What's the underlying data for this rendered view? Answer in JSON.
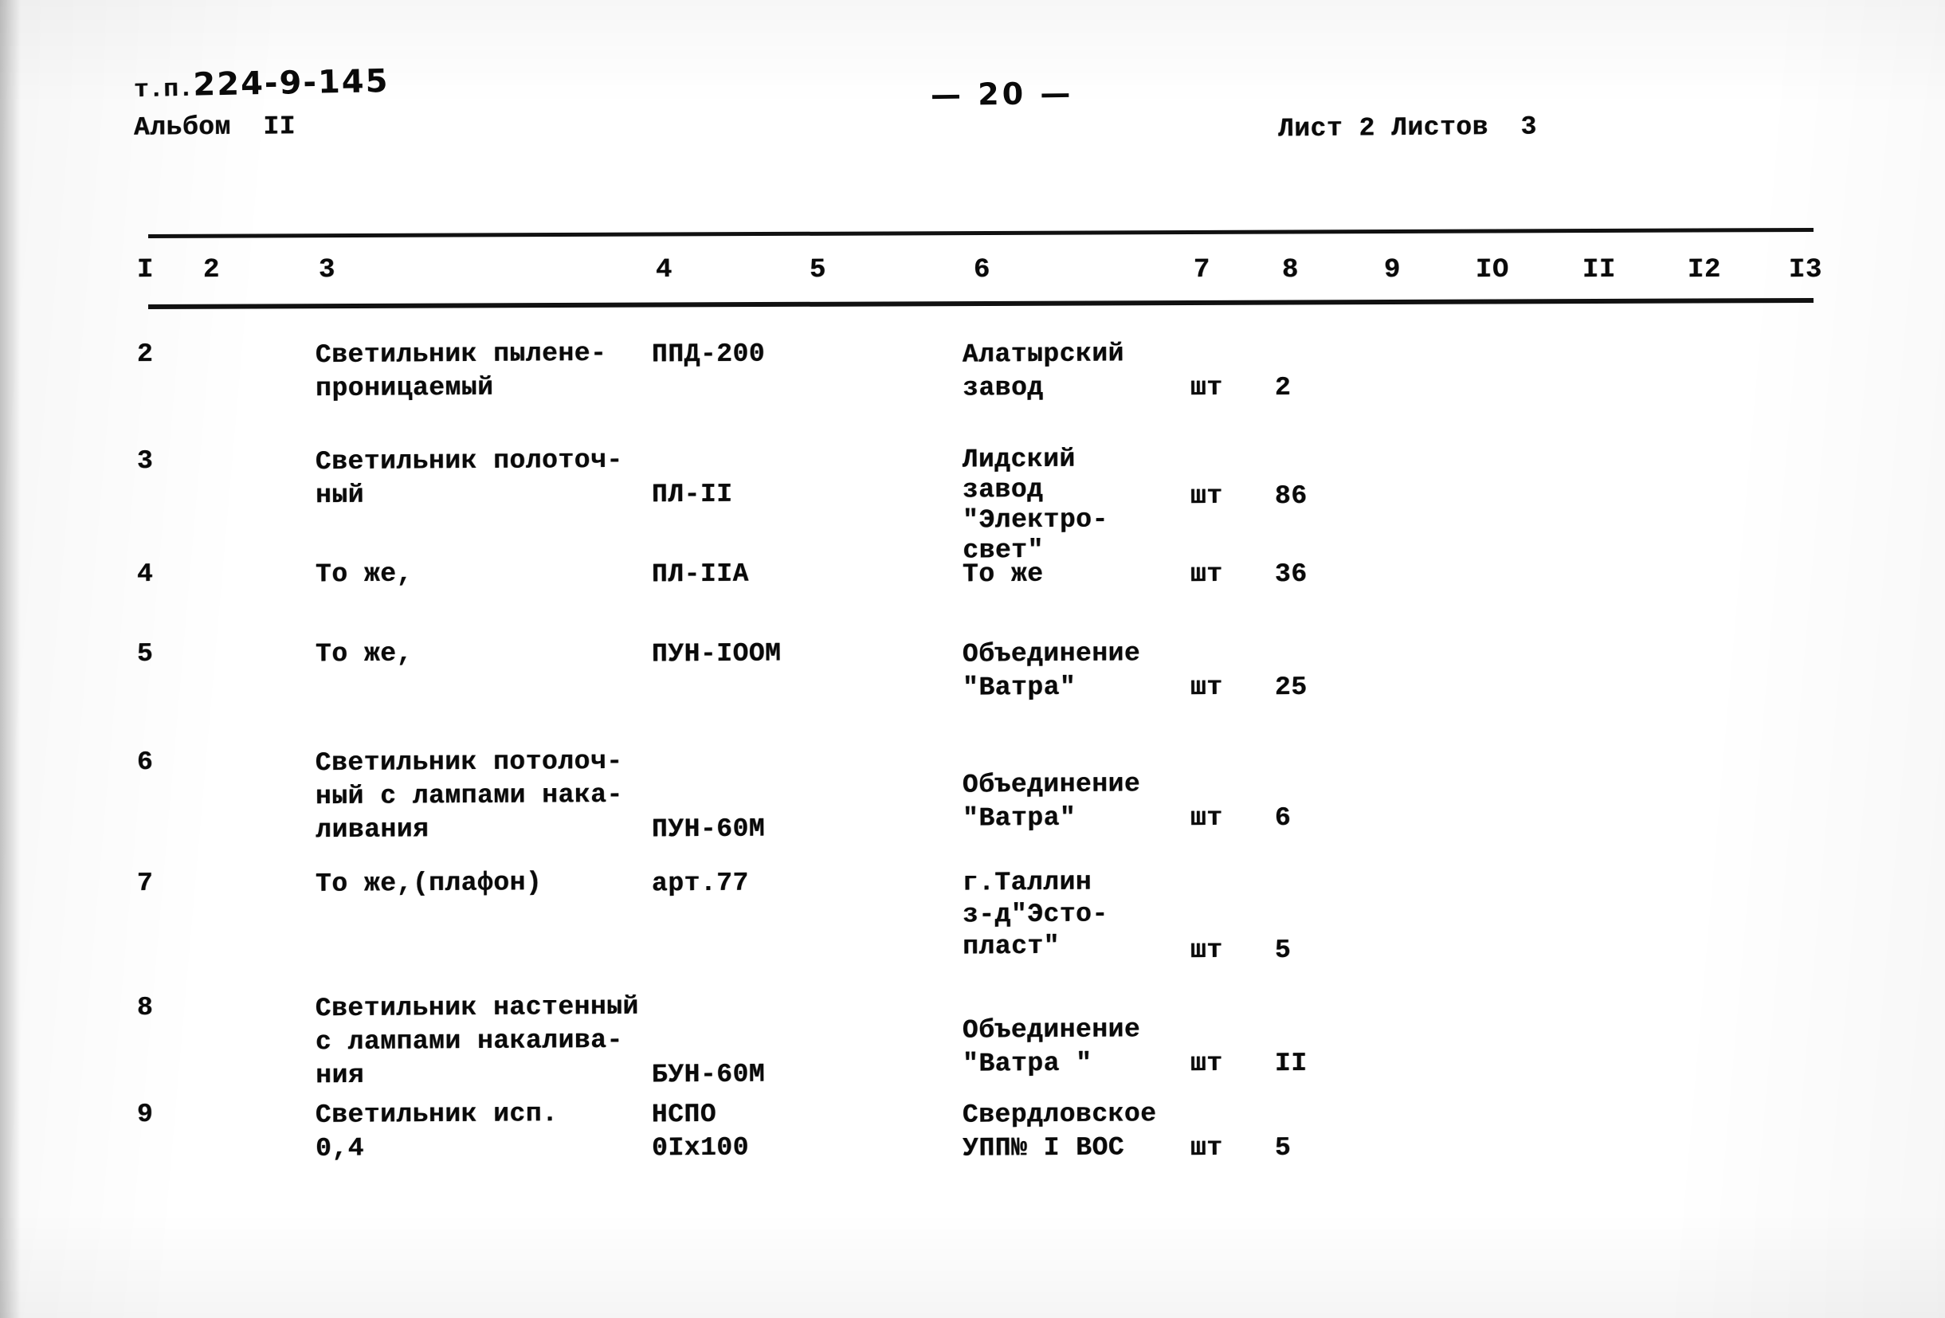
{
  "header": {
    "doc_code_prefix": "т.п.",
    "doc_code": "224-9-145",
    "album_label": "Альбом",
    "album_number": "II",
    "page_marker": "— 20 —",
    "sheet_text": "Лист 2 Листов  3"
  },
  "table": {
    "column_numbers": [
      "I",
      "2",
      "3",
      "4",
      "5",
      "6",
      "7",
      "8",
      "9",
      "IO",
      "II",
      "I2",
      "I3"
    ],
    "rows": [
      {
        "num": "2",
        "name": "Светильник пылене-\nпроницаемый",
        "type": "ППД-200",
        "manufacturer": "Алатырский\nзавод",
        "unit": "шт",
        "qty": "2"
      },
      {
        "num": "3",
        "name": "Светильник полоточ-\nный",
        "type": "ПЛ-II",
        "manufacturer": "Лидский\nзавод\n\"Электро-\nсвет\"",
        "unit": "шт",
        "qty": "86"
      },
      {
        "num": "4",
        "name": "То же,",
        "type": "ПЛ-IIA",
        "manufacturer": "То же",
        "unit": "шт",
        "qty": "36"
      },
      {
        "num": "5",
        "name": "То же,",
        "type": "ПУН-IOOM",
        "manufacturer": "Объединение\n\"Ватра\"",
        "unit": "шт",
        "qty": "25"
      },
      {
        "num": "6",
        "name": "Светильник потолоч-\nный с лампами нака-\nливания",
        "type": "ПУН-60М",
        "manufacturer": "Объединение\n\"Ватра\"",
        "unit": "шт",
        "qty": "6"
      },
      {
        "num": "7",
        "name": "То же,(плафон)",
        "type": "арт.77",
        "manufacturer": "г.Таллин\nз-д\"Эсто-\nпласт\"",
        "unit": "шт",
        "qty": "5"
      },
      {
        "num": "8",
        "name": "Светильник настенный\nс лампами накалива-\nния",
        "type": "БУН-60М",
        "manufacturer": "Объединение\n\"Ватра \"",
        "unit": "шт",
        "qty": "II"
      },
      {
        "num": "9",
        "name": "Светильник исп.\n0,4",
        "type": "НСПО\n0Iх100",
        "manufacturer": "Свердловское\nУПП№ I ВОС",
        "unit": "шт",
        "qty": "5"
      }
    ]
  }
}
